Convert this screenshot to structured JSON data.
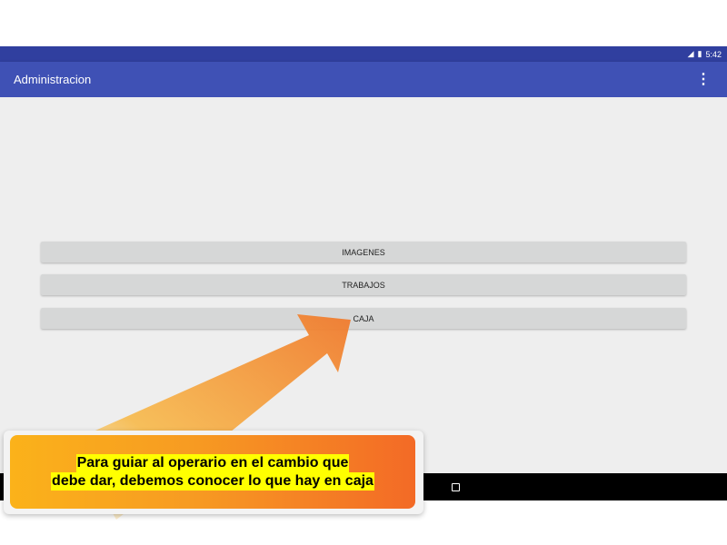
{
  "status_bar": {
    "time": "5:42",
    "signal_icon": "signal-icon",
    "battery_icon": "battery-icon"
  },
  "toolbar": {
    "title": "Administracion",
    "overflow_icon": "more-vert-icon",
    "overflow_glyph": "⋮"
  },
  "menu_buttons": [
    {
      "label": "IMAGENES"
    },
    {
      "label": "TRABAJOS"
    },
    {
      "label": "CAJA"
    }
  ],
  "callout": {
    "line1": "Para guiar al operario en el cambio que",
    "line2": "debe dar, debemos conocer lo que hay en caja"
  },
  "nav_bar": {
    "recents_icon": "recents-icon"
  },
  "colors": {
    "primary": "#3f51b5",
    "primary_dark": "#303f9f",
    "button": "#d6d7d7",
    "content_bg": "#eeeeee",
    "callout_start": "#fbb21a",
    "callout_end": "#f36a26",
    "highlight": "#ffff00"
  }
}
